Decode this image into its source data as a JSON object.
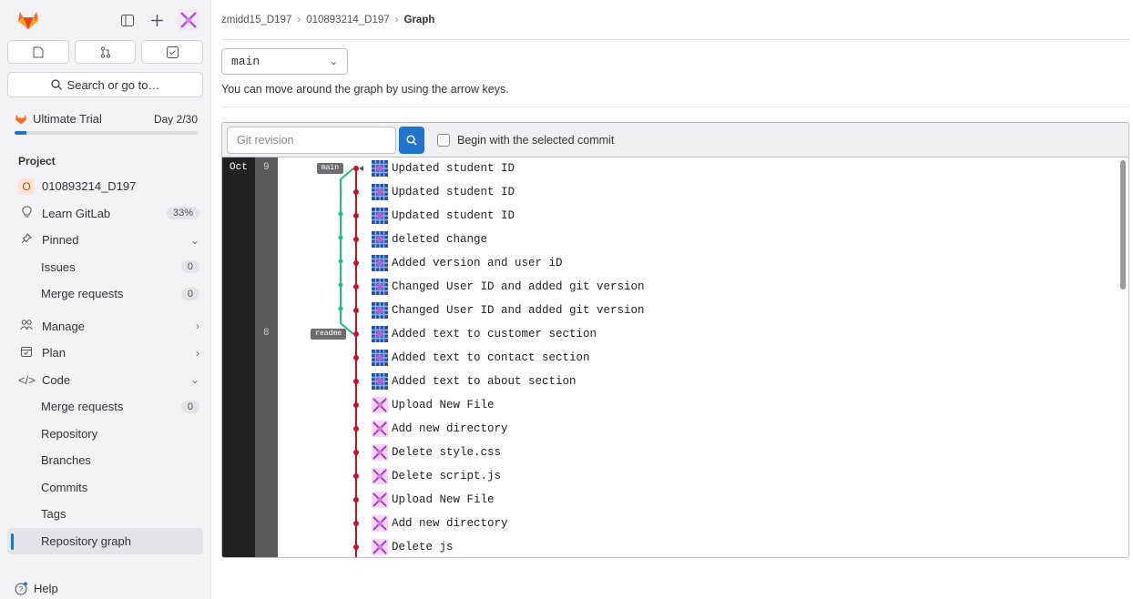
{
  "sidebar": {
    "search_label": "Search or go to…",
    "trial": {
      "label": "Ultimate Trial",
      "day": "Day 2/30",
      "progress": 0.067
    },
    "section_label": "Project",
    "project_initial": "O",
    "project_name": "010893214_D197",
    "learn": {
      "label": "Learn GitLab",
      "badge": "33%"
    },
    "pinned": {
      "label": "Pinned",
      "items": [
        {
          "label": "Issues",
          "count": "0"
        },
        {
          "label": "Merge requests",
          "count": "0"
        }
      ]
    },
    "manage_label": "Manage",
    "plan_label": "Plan",
    "code": {
      "label": "Code",
      "items": [
        {
          "label": "Merge requests",
          "count": "0"
        },
        {
          "label": "Repository"
        },
        {
          "label": "Branches"
        },
        {
          "label": "Commits"
        },
        {
          "label": "Tags"
        },
        {
          "label": "Repository graph"
        }
      ]
    },
    "help_label": "Help"
  },
  "breadcrumb": [
    "zmidd15_D197",
    "010893214_D197",
    "Graph"
  ],
  "ref_select": {
    "value": "main"
  },
  "hint": "You can move around the graph by using the arrow keys.",
  "toolbar": {
    "revision_placeholder": "Git revision",
    "checkbox_label": "Begin with the selected commit"
  },
  "graph": {
    "month": "Oct",
    "days": [
      {
        "label": "9",
        "row": 0
      },
      {
        "label": "8",
        "row": 7
      }
    ],
    "refs": [
      {
        "name": "main",
        "row": 0
      },
      {
        "name": "readme",
        "row": 7
      }
    ],
    "commits": [
      {
        "message": "Updated student ID",
        "avatar": "blue"
      },
      {
        "message": "Updated student ID",
        "avatar": "blue"
      },
      {
        "message": "Updated student ID",
        "avatar": "blue"
      },
      {
        "message": "deleted change",
        "avatar": "blue"
      },
      {
        "message": "Added version and user iD",
        "avatar": "blue"
      },
      {
        "message": "Changed User ID and added git version",
        "avatar": "blue"
      },
      {
        "message": "Changed User ID and added git version",
        "avatar": "blue"
      },
      {
        "message": "Added text to customer section",
        "avatar": "blue"
      },
      {
        "message": "Added text to contact section",
        "avatar": "blue"
      },
      {
        "message": "Added text to about section",
        "avatar": "blue"
      },
      {
        "message": "Upload New File",
        "avatar": "pink"
      },
      {
        "message": "Add new directory",
        "avatar": "pink"
      },
      {
        "message": "Delete style.css",
        "avatar": "pink"
      },
      {
        "message": "Delete script.js",
        "avatar": "pink"
      },
      {
        "message": "Upload New File",
        "avatar": "pink"
      },
      {
        "message": "Add new directory",
        "avatar": "pink"
      },
      {
        "message": "Delete js",
        "avatar": "pink"
      }
    ],
    "colors": {
      "main_line": "#c7102a",
      "branch_line": "#1ec07a",
      "date_col": "#222222",
      "day_col": "#5a5a5a"
    }
  }
}
